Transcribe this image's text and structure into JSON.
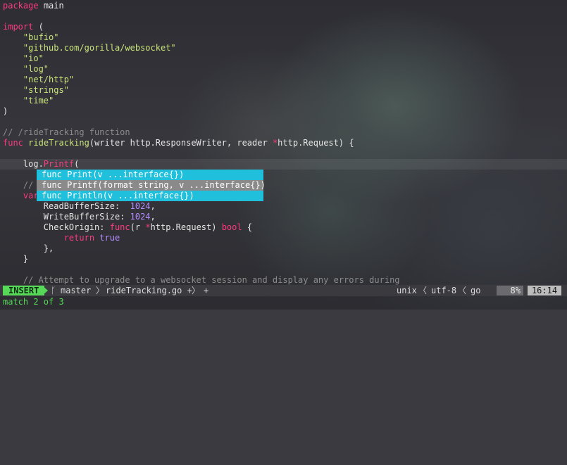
{
  "editor": {
    "lines": [
      {
        "t": "package main"
      },
      {
        "t": ""
      },
      {
        "t": "import ("
      },
      {
        "t": "\t\"bufio\""
      },
      {
        "t": "\t\"github.com/gorilla/websocket\""
      },
      {
        "t": "\t\"io\""
      },
      {
        "t": "\t\"log\""
      },
      {
        "t": "\t\"net/http\""
      },
      {
        "t": "\t\"strings\""
      },
      {
        "t": "\t\"time\""
      },
      {
        "t": ")"
      },
      {
        "t": ""
      },
      {
        "t": "// /rideTracking function"
      },
      {
        "t": "func rideTracking(writer http.ResponseWriter, reader *http.Request) {"
      },
      {
        "t": ""
      },
      {
        "t": "\tlog.Printf("
      },
      {
        "t": ""
      },
      {
        "t": "\t// "
      },
      {
        "t": "\tvar"
      },
      {
        "t": "\t\tReadBufferSize:  1024,"
      },
      {
        "t": "\t\tWriteBufferSize: 1024,"
      },
      {
        "t": "\t\tCheckOrigin: func(r *http.Request) bool {"
      },
      {
        "t": "\t\t\treturn true"
      },
      {
        "t": "\t\t},"
      },
      {
        "t": "\t}"
      },
      {
        "t": ""
      },
      {
        "t": "\t// Attempt to upgrade to a websocket session and display any errors during"
      }
    ]
  },
  "completion": {
    "items": [
      "func Print(v ...interface{})",
      "func Printf(format string, v ...interface{})",
      "func Println(v ...interface{})"
    ],
    "selected_index": 1
  },
  "statusbar": {
    "mode": "INSERT",
    "branch": "master",
    "file": "rideTracking.go +",
    "extra": "+",
    "fileformat": "unix",
    "encoding": "utf-8",
    "filetype": "go",
    "percent": "8%",
    "position": "16:14"
  },
  "cmdline": "match 2 of 3",
  "colors": {
    "keyword": "#ff3b7f",
    "string": "#c9e47a",
    "comment": "#8c8c8c",
    "number": "#b58cff",
    "popup": "#20c0dc",
    "popup_selected": "#8a8a8a",
    "insert_mode": "#55d957"
  }
}
